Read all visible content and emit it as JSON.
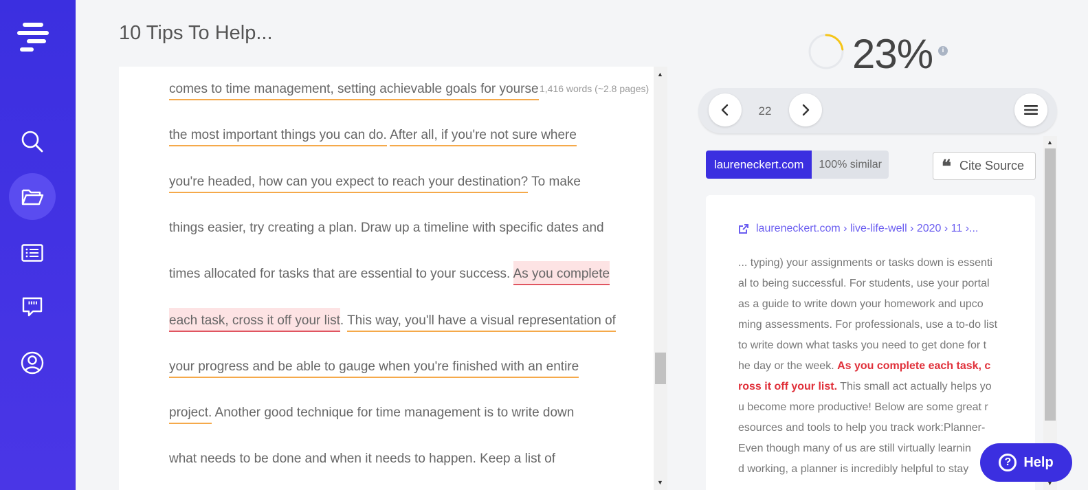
{
  "document": {
    "title": "10 Tips To Help...",
    "word_count": "1,416 words (~2.8 pages)",
    "lines": [
      [
        {
          "t": "comes to time management, setting achievable goals for yourse",
          "s": "orange"
        }
      ],
      [
        {
          "t": "the most important things you can do.",
          "s": "orange"
        },
        {
          "t": " ",
          "s": ""
        },
        {
          "t": "After all, if you're not sure where",
          "s": "orange"
        }
      ],
      [
        {
          "t": "you're headed, how can you expect to reach your destination?",
          "s": "orange"
        },
        {
          "t": " To make",
          "s": ""
        }
      ],
      [
        {
          "t": "things easier, try creating a plan. Draw up a timeline with specific dates and",
          "s": ""
        }
      ],
      [
        {
          "t": "times allocated for tasks that are essential to your success. ",
          "s": ""
        },
        {
          "t": "As you complete",
          "s": "red"
        }
      ],
      [
        {
          "t": "each task, cross it off your list",
          "s": "red"
        },
        {
          "t": ". ",
          "s": ""
        },
        {
          "t": "This way, you'll have a visual representation of",
          "s": "orange"
        }
      ],
      [
        {
          "t": "your progress and be able to gauge when you're finished with an entire",
          "s": "orange"
        }
      ],
      [
        {
          "t": "project.",
          "s": "orange"
        },
        {
          "t": " Another good technique for time management is to write down",
          "s": ""
        }
      ],
      [
        {
          "t": "what needs to be done and when it needs to happen. Keep a list of",
          "s": ""
        }
      ]
    ]
  },
  "score": {
    "value": "23%",
    "fraction": 0.23,
    "ring_color": "#f5c518",
    "info_icon": "info-icon"
  },
  "pager": {
    "page": "22",
    "prev_icon": "chevron-left-icon",
    "next_icon": "chevron-right-icon",
    "menu_icon": "hamburger-menu-icon"
  },
  "source": {
    "domain": "laureneckert.com",
    "similarity": "100% similar",
    "cite_label": "Cite Source",
    "url": "laureneckert.com › live-life-well › 2020 › 11 ›...",
    "text_lines": [
      [
        {
          "t": "... typing) your assignments or tasks down is essenti",
          "h": false
        }
      ],
      [
        {
          "t": "al to being successful. For students, use your portal",
          "h": false
        }
      ],
      [
        {
          "t": "as a guide to write down your homework and upco",
          "h": false
        }
      ],
      [
        {
          "t": "ming assessments. For professionals, use a to-do list",
          "h": false
        }
      ],
      [
        {
          "t": "to write down what tasks you need to get done for t",
          "h": false
        }
      ],
      [
        {
          "t": "he day or the week. ",
          "h": false
        },
        {
          "t": "As you complete each task, c",
          "h": true
        }
      ],
      [
        {
          "t": "ross it off your list.",
          "h": true
        },
        {
          "t": " This small act actually helps yo",
          "h": false
        }
      ],
      [
        {
          "t": "u become more productive! Below are some great r",
          "h": false
        }
      ],
      [
        {
          "t": "esources and tools to help you track work:Planner-",
          "h": false
        }
      ],
      [
        {
          "t": "Even though many of us are still virtually learnin",
          "h": false
        }
      ],
      [
        {
          "t": "d working, a planner is incredibly helpful to stay",
          "h": false
        }
      ]
    ]
  },
  "help": {
    "label": "Help"
  },
  "colors": {
    "brand": "#3b2fe0",
    "orange_underline": "#f5a94a",
    "red_highlight": "#e05560"
  }
}
